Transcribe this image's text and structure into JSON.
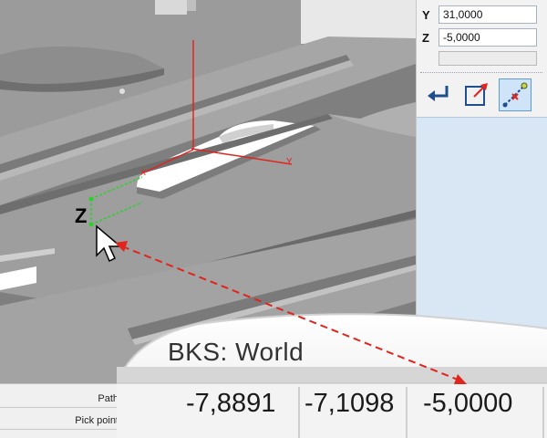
{
  "panel": {
    "y_label": "Y",
    "y_value": "31,0000",
    "z_label": "Z",
    "z_value": "-5,0000",
    "tools": [
      {
        "icon": "return-arrow-icon",
        "active": false
      },
      {
        "icon": "relative-point-icon",
        "active": false
      },
      {
        "icon": "pick-point-icon",
        "active": true
      }
    ]
  },
  "viewport": {
    "axis_y_label": "Y",
    "axis_x_label": "X",
    "z_marker_label": "Z"
  },
  "bottom": {
    "row1_label": "Path",
    "row2_label": "Pick point"
  },
  "callout": {
    "bks_label": "BKS: World",
    "x_value": "-7,8891",
    "y_value": "-7,1098",
    "z_value": "-5,0000"
  },
  "colors": {
    "accent_red": "#e1241d",
    "axis_green": "#2bd12b",
    "panel_blue": "#d9e6f4",
    "active_tool": "#cfe4f8"
  }
}
